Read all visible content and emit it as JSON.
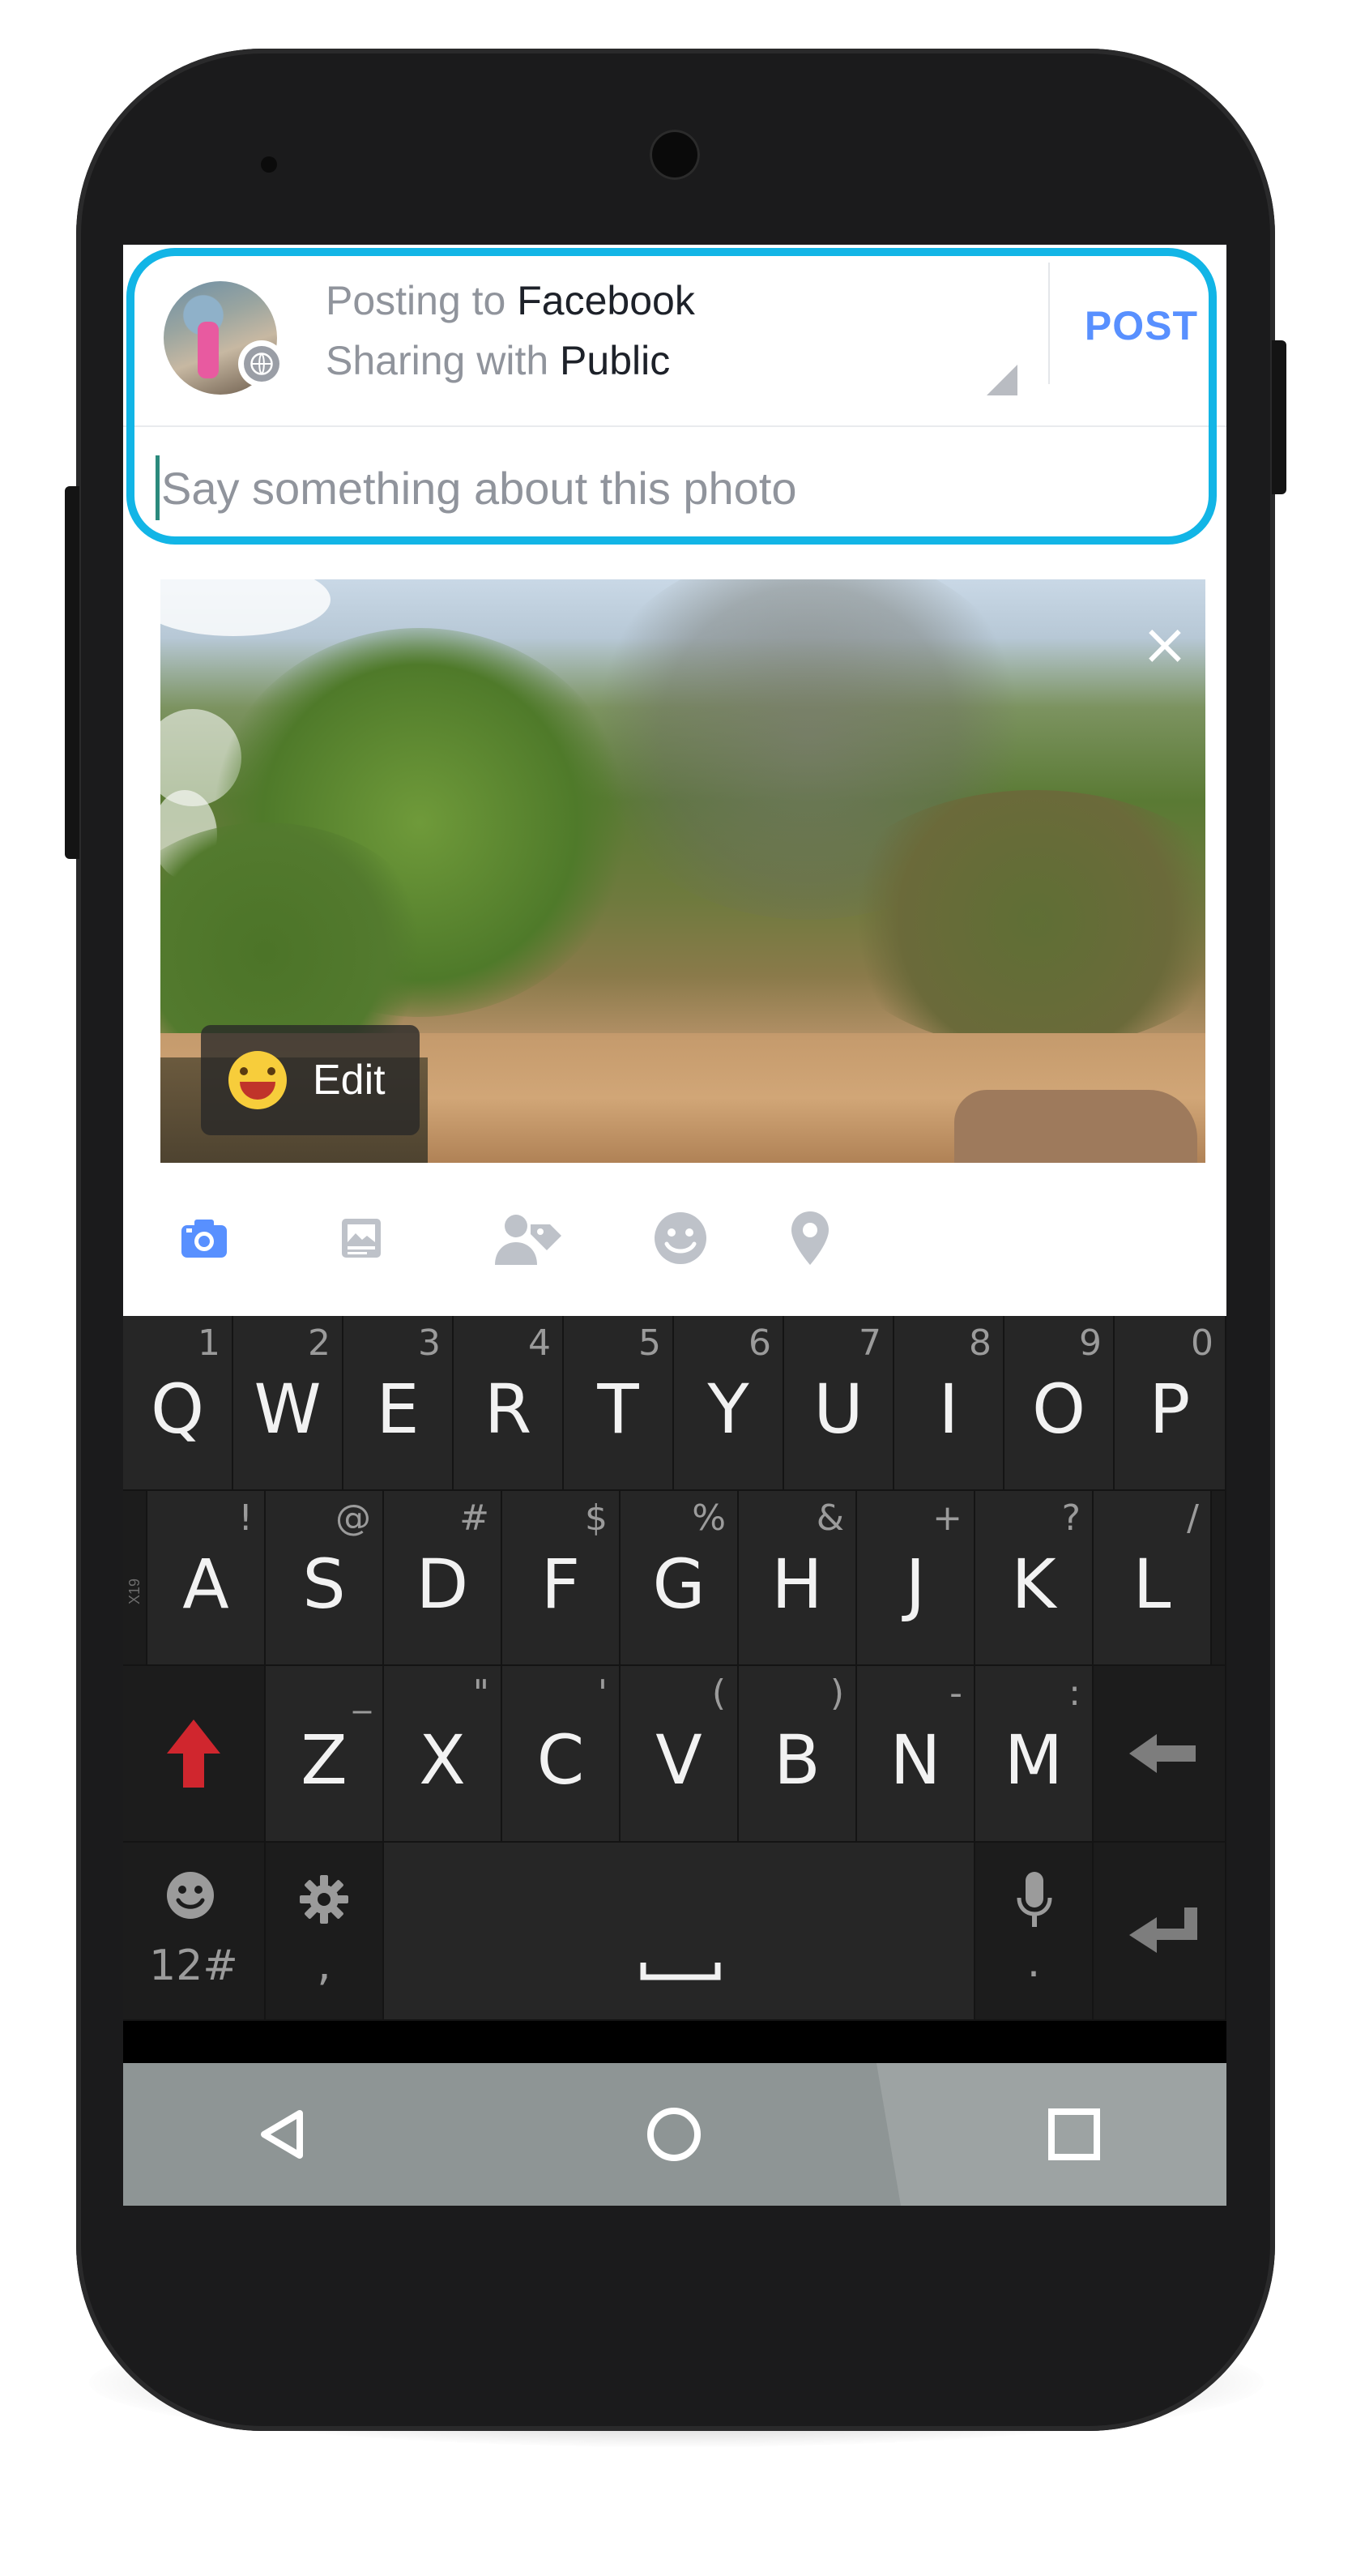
{
  "header": {
    "posting_prefix": "Posting to ",
    "posting_target": "Facebook",
    "sharing_prefix": "Sharing with ",
    "sharing_audience": "Public",
    "post_label": "POST"
  },
  "composer": {
    "placeholder": "Say something about this photo"
  },
  "photo": {
    "close_glyph": "×",
    "edit_label": "Edit"
  },
  "toolbar": {
    "items": [
      "camera-icon",
      "photo-album-icon",
      "tag-people-icon",
      "feeling-icon",
      "location-icon"
    ],
    "active_color": "#5890ff",
    "inactive_color": "#bec2c9"
  },
  "keyboard": {
    "row1": [
      {
        "k": "Q",
        "n": "1"
      },
      {
        "k": "W",
        "n": "2"
      },
      {
        "k": "E",
        "n": "3"
      },
      {
        "k": "R",
        "n": "4"
      },
      {
        "k": "T",
        "n": "5"
      },
      {
        "k": "Y",
        "n": "6"
      },
      {
        "k": "U",
        "n": "7"
      },
      {
        "k": "I",
        "n": "8"
      },
      {
        "k": "O",
        "n": "9"
      },
      {
        "k": "P",
        "n": "0"
      }
    ],
    "row2": [
      {
        "k": "A",
        "n": "!"
      },
      {
        "k": "S",
        "n": "@"
      },
      {
        "k": "D",
        "n": "#"
      },
      {
        "k": "F",
        "n": "$"
      },
      {
        "k": "G",
        "n": "%"
      },
      {
        "k": "H",
        "n": "&"
      },
      {
        "k": "J",
        "n": "+"
      },
      {
        "k": "K",
        "n": "?"
      },
      {
        "k": "L",
        "n": "/"
      }
    ],
    "row3": [
      {
        "k": "Z",
        "n": "_"
      },
      {
        "k": "X",
        "n": "\""
      },
      {
        "k": "C",
        "n": "'"
      },
      {
        "k": "V",
        "n": "("
      },
      {
        "k": "B",
        "n": ")"
      },
      {
        "k": "N",
        "n": "-"
      },
      {
        "k": "M",
        "n": ":"
      }
    ],
    "side_tag": "X19",
    "numbers_label": "12#",
    "comma_label": ",",
    "period_label": ".",
    "shift_color": "#d0262e",
    "key_color": "#262626"
  },
  "navbar": {
    "buttons": [
      "back-icon",
      "home-icon",
      "recents-icon"
    ]
  },
  "colors": {
    "highlight": "#12b5e6",
    "post_blue": "#5890ff"
  }
}
